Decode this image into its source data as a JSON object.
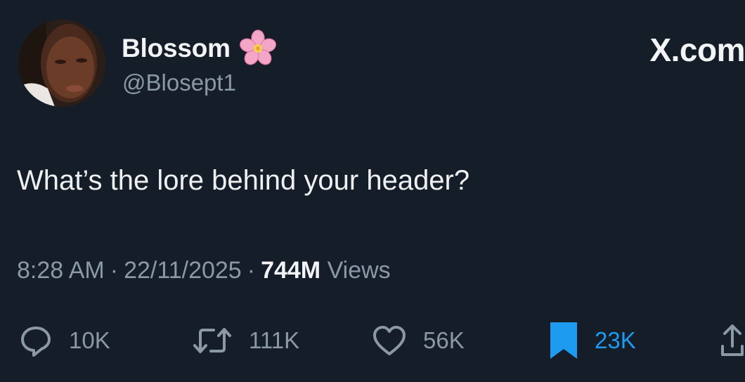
{
  "author": {
    "display_name": "Blossom",
    "handle": "@Blosept1",
    "badge_icon": "cherry-blossom-icon"
  },
  "site_logo": "X.com",
  "tweet": {
    "text": "What’s the lore behind your header?"
  },
  "meta": {
    "time": "8:28 AM",
    "separator": "·",
    "date": "22/11/2025",
    "views_count": "744M",
    "views_label": "Views"
  },
  "actions": {
    "replies": {
      "icon": "reply-icon",
      "count": "10K"
    },
    "reposts": {
      "icon": "repost-icon",
      "count": "111K"
    },
    "likes": {
      "icon": "heart-icon",
      "count": "56K"
    },
    "bookmarks": {
      "icon": "bookmark-icon",
      "count": "23K",
      "active": true
    },
    "share": {
      "icon": "share-icon"
    }
  },
  "colors": {
    "background": "#151d28",
    "text_primary": "#f2f4f5",
    "text_secondary": "#8b98a5",
    "accent": "#1d9bf0"
  }
}
